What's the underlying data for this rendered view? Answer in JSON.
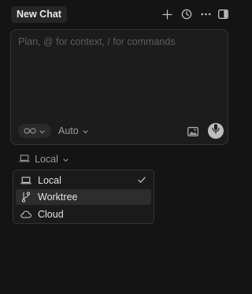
{
  "header": {
    "tab_label": "New Chat",
    "icons": [
      "plus-icon",
      "history-icon",
      "more-icon",
      "toggle-panel-icon"
    ]
  },
  "composer": {
    "placeholder": "Plan, @ for context, / for commands",
    "mode_icon": "infinity-icon",
    "model_label": "Auto",
    "image_icon": "image-icon",
    "mic_icon": "microphone-icon"
  },
  "location": {
    "selected_label": "Local",
    "menu": [
      {
        "label": "Local",
        "icon": "laptop-icon",
        "checked": true,
        "hovered": false
      },
      {
        "label": "Worktree",
        "icon": "git-branch-icon",
        "checked": false,
        "hovered": true
      },
      {
        "label": "Cloud",
        "icon": "cloud-icon",
        "checked": false,
        "hovered": false
      }
    ]
  },
  "colors": {
    "background": "#141414",
    "composer_bg": "#1c1c1c",
    "tab_bg": "#262626",
    "mic_bg": "#bdbdbd",
    "menu_hover": "#2d2d2d"
  }
}
